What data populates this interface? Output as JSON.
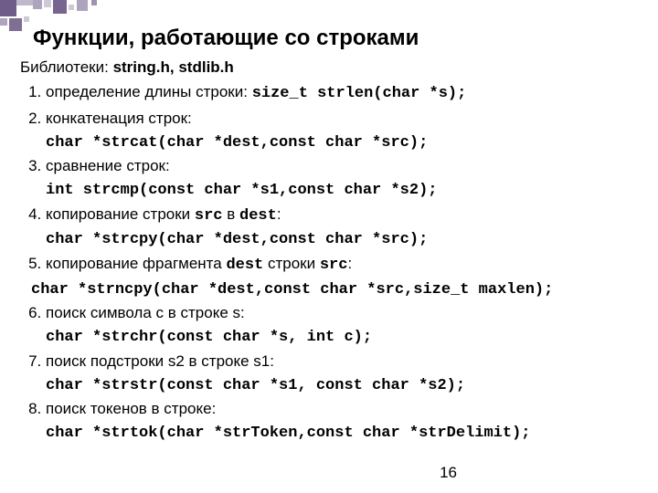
{
  "title": "Функции, работающие со строками",
  "libline_prefix": "Библиотеки: ",
  "libline_bold": "string.h, stdlib.h",
  "items": [
    {
      "desc_pre": "определение длины строки: ",
      "desc_mono": "size_t strlen(char *s);",
      "code": ""
    },
    {
      "desc_pre": "конкатенация строк:",
      "desc_mono": "",
      "code": "char *strcat(char *dest,const char *src);"
    },
    {
      "desc_pre": "сравнение строк:",
      "desc_mono": "",
      "code": "int strcmp(const char *s1,const char *s2);"
    },
    {
      "desc_pre": "копирование строки ",
      "desc_mono": "src",
      "desc_post": " в ",
      "desc_mono2": "dest",
      "desc_end": ":",
      "code": "char *strcpy(char *dest,const char *src);"
    },
    {
      "desc_pre": "копирование фрагмента ",
      "desc_mono": "dest",
      "desc_post": " строки ",
      "desc_mono2": "src",
      "desc_end": ":",
      "code_wide": "char *strncpy(char *dest,const char *src,size_t maxlen);"
    },
    {
      "desc_pre": "поиск символа с в строке s:",
      "desc_mono": "",
      "code": "char *strchr(const char *s, int c);"
    },
    {
      "desc_pre": "поиск подстроки s2 в строке s1:",
      "desc_mono": "",
      "code": "char *strstr(const char *s1, const char *s2);"
    },
    {
      "desc_pre": "поиск токенов в строке:",
      "desc_mono": "",
      "code": "char *strtok(char *strToken,const char *strDelimit);"
    }
  ],
  "page_number": "16"
}
